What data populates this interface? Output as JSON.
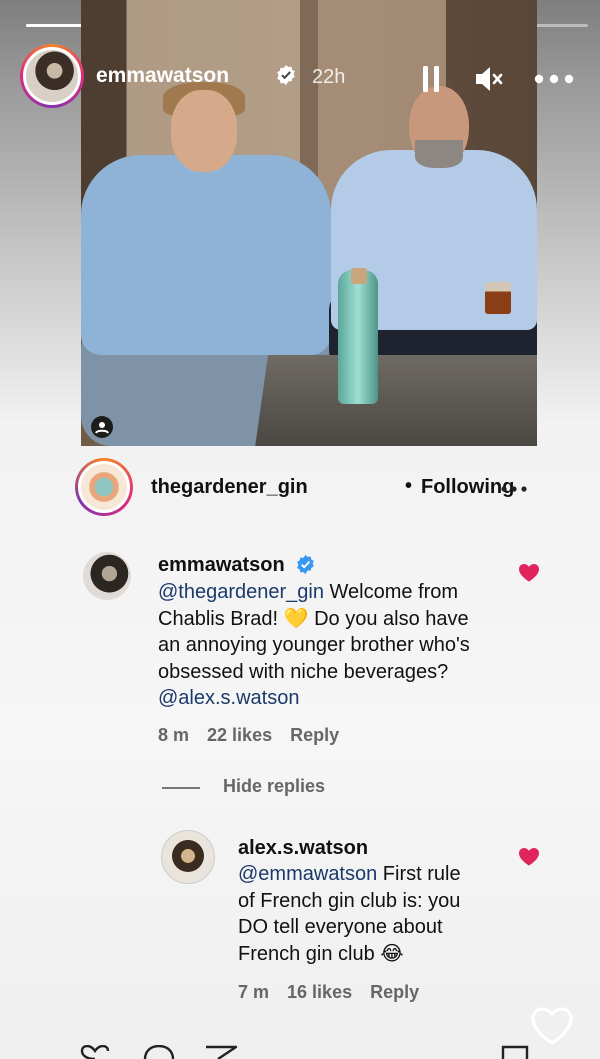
{
  "story": {
    "username": "emmawatson",
    "time": "22h",
    "progress": [
      1.0,
      0.0
    ]
  },
  "post": {
    "account": "thegardener_gin",
    "separator": "•",
    "follow_status": "Following"
  },
  "comments": [
    {
      "username": "emmawatson",
      "verified": true,
      "text_lines": [
        {
          "mention": "@thegardener_gin",
          "text": " Welcome from"
        },
        {
          "mention": "",
          "text": "Chablis Brad! 💛 Do you also have"
        },
        {
          "mention": "",
          "text": "an annoying younger brother who's"
        },
        {
          "mention": "",
          "text": "obsessed with niche beverages?"
        },
        {
          "mention": "@alex.s.watson",
          "text": ""
        }
      ],
      "time": "8 m",
      "likes": "22 likes",
      "reply": "Reply"
    },
    {
      "username": "alex.s.watson",
      "verified": false,
      "text_lines": [
        {
          "mention": "@emmawatson",
          "text": " First rule"
        },
        {
          "mention": "",
          "text": "of French gin club is: you"
        },
        {
          "mention": "",
          "text": "DO tell everyone about"
        },
        {
          "mention": "",
          "text": "French gin club 😂"
        }
      ],
      "time": "7 m",
      "likes": "16 likes",
      "reply": "Reply"
    }
  ],
  "hide_replies_label": "Hide replies",
  "colors": {
    "heart": "#e0245e",
    "verified": "#3897f0",
    "mention": "#1b3a6b"
  },
  "icons": [
    "pause-icon",
    "mute-icon",
    "more-icon",
    "verified-icon",
    "heart-icon",
    "like-story-icon"
  ]
}
